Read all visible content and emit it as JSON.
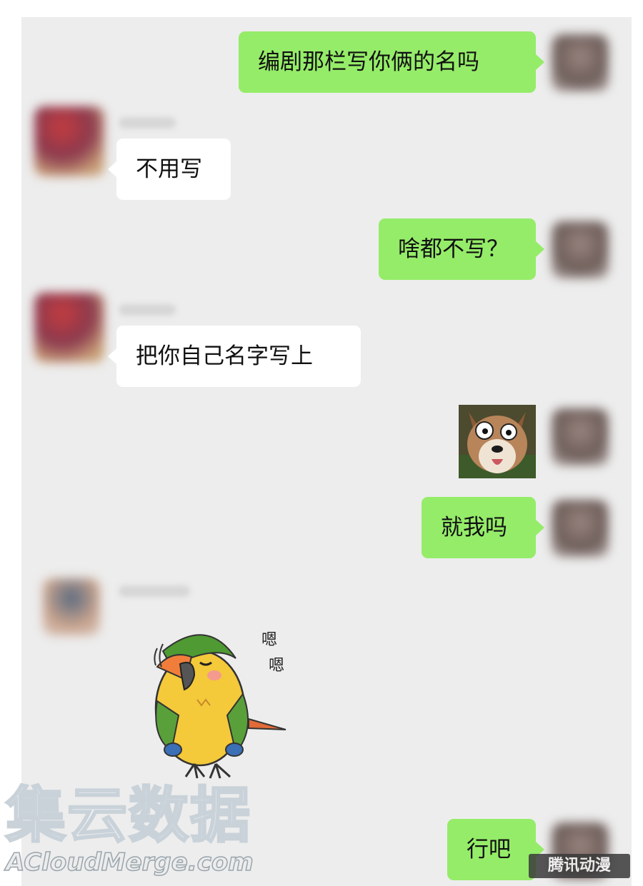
{
  "messages": [
    {
      "side": "me",
      "text": "编剧那栏写你俩的名吗"
    },
    {
      "side": "other",
      "text": "不用写"
    },
    {
      "side": "me",
      "text": "啥都不写？"
    },
    {
      "side": "other",
      "text": "把你自己名字写上"
    },
    {
      "side": "me",
      "sticker": "surprised-shiba-dog-sticker"
    },
    {
      "side": "me",
      "text": "就我吗"
    },
    {
      "side": "other",
      "sticker": "nodding-parrot-sticker",
      "sticker_text": [
        "嗯",
        "嗯"
      ]
    },
    {
      "side": "me",
      "text": "行吧"
    }
  ],
  "watermark": {
    "cn": "集云数据",
    "en": "ACloudMerge.com",
    "corner": "腾讯动漫"
  },
  "colors": {
    "background": "#ededed",
    "my_bubble": "#95ec69",
    "their_bubble": "#ffffff"
  }
}
